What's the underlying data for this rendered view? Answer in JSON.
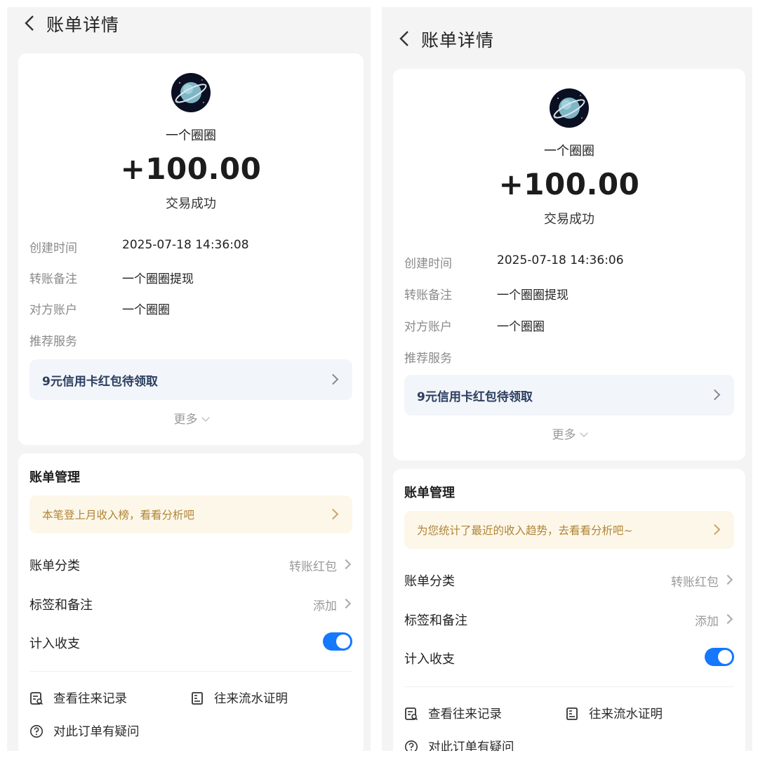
{
  "left": {
    "title": "账单详情",
    "payee_name": "一个圈圈",
    "amount": "+100.00",
    "status": "交易成功",
    "details": [
      {
        "label": "创建时间",
        "value": "2025-07-18 14:36:08"
      },
      {
        "label": "转账备注",
        "value": "一个圈圈提现"
      },
      {
        "label": "对方账户",
        "value": "一个圈圈"
      },
      {
        "label": "推荐服务",
        "value": ""
      }
    ],
    "promo": "9元信用卡红包待领取",
    "more": "更多",
    "manage_title": "账单管理",
    "tip": "本笔登上月收入榜，看看分析吧",
    "category_label": "账单分类",
    "category_value": "转账红包",
    "tags_label": "标签和备注",
    "tags_value": "添加",
    "include_label": "计入收支",
    "include_on": true,
    "link_history": "查看往来记录",
    "link_proof": "往来流水证明",
    "link_question": "对此订单有疑问"
  },
  "right": {
    "title": "账单详情",
    "payee_name": "一个圈圈",
    "amount": "+100.00",
    "status": "交易成功",
    "details": [
      {
        "label": "创建时间",
        "value": "2025-07-18 14:36:06"
      },
      {
        "label": "转账备注",
        "value": "一个圈圈提现"
      },
      {
        "label": "对方账户",
        "value": "一个圈圈"
      },
      {
        "label": "推荐服务",
        "value": ""
      }
    ],
    "promo": "9元信用卡红包待领取",
    "more": "更多",
    "manage_title": "账单管理",
    "tip": "为您统计了最近的收入趋势，去看看分析吧~",
    "category_label": "账单分类",
    "category_value": "转账红包",
    "tags_label": "标签和备注",
    "tags_value": "添加",
    "include_label": "计入收支",
    "include_on": true,
    "link_history": "查看往来记录",
    "link_proof": "往来流水证明",
    "link_question": "对此订单有疑问"
  },
  "colors": {
    "accent": "#1677ff",
    "tip_text": "#b08432",
    "promo_text": "#2b3e5f",
    "background": "#f4f4f4"
  },
  "icons": [
    "back-arrow-icon",
    "planet-avatar-icon",
    "chevron-right-icon",
    "chevron-down-icon",
    "record-search-icon",
    "statement-icon",
    "question-icon"
  ]
}
